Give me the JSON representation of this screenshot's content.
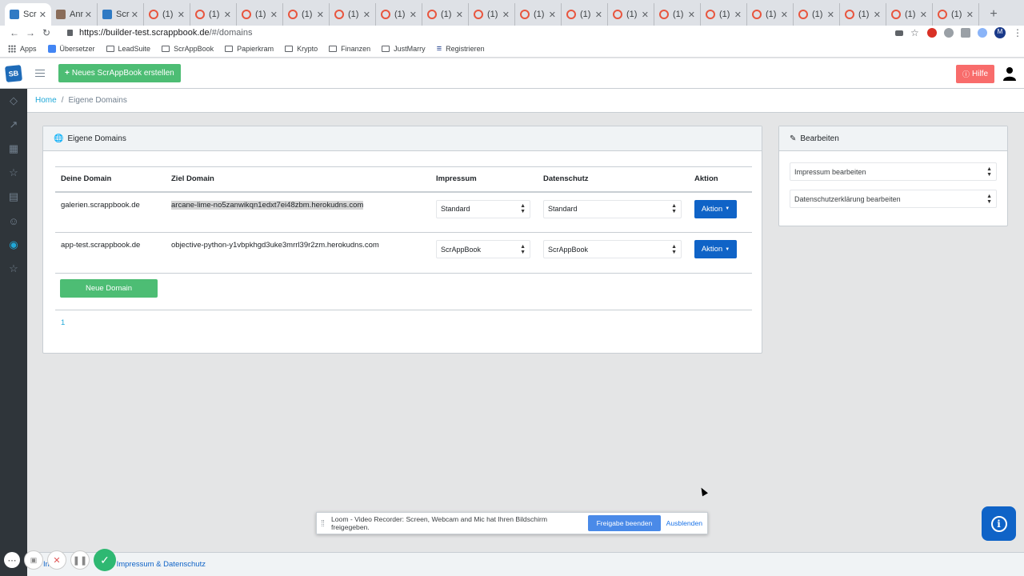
{
  "browser": {
    "tabs": [
      {
        "title": "Scr",
        "icon": "scrappbook-favicon",
        "active": true
      },
      {
        "title": "Ann",
        "icon": "photo-favicon"
      },
      {
        "title": "Scr",
        "icon": "scrappbook-favicon"
      },
      {
        "title": "(1)",
        "icon": "spiral-favicon"
      },
      {
        "title": "(1)",
        "icon": "spiral-favicon"
      },
      {
        "title": "(1)",
        "icon": "spiral-favicon"
      },
      {
        "title": "(1)",
        "icon": "spiral-favicon"
      },
      {
        "title": "(1)",
        "icon": "spiral-favicon"
      },
      {
        "title": "(1)",
        "icon": "spiral-favicon"
      },
      {
        "title": "(1)",
        "icon": "spiral-favicon"
      },
      {
        "title": "(1)",
        "icon": "spiral-favicon"
      },
      {
        "title": "(1)",
        "icon": "spiral-favicon"
      },
      {
        "title": "(1)",
        "icon": "spiral-favicon"
      },
      {
        "title": "(1)",
        "icon": "spiral-favicon"
      },
      {
        "title": "(1)",
        "icon": "spiral-favicon"
      },
      {
        "title": "(1)",
        "icon": "spiral-favicon"
      },
      {
        "title": "(1)",
        "icon": "spiral-favicon"
      },
      {
        "title": "(1)",
        "icon": "spiral-favicon"
      },
      {
        "title": "(1)",
        "icon": "spiral-favicon"
      },
      {
        "title": "(1)",
        "icon": "spiral-favicon"
      },
      {
        "title": "(1)",
        "icon": "spiral-favicon"
      }
    ],
    "url_host": "https://builder-test.scrappbook.de",
    "url_path": "/#/domains",
    "profile_initial": "M",
    "bookmarks": [
      {
        "label": "Apps",
        "icon": "apps-grid-icon"
      },
      {
        "label": "Übersetzer",
        "icon": "translate-icon"
      },
      {
        "label": "LeadSuite",
        "icon": "folder-icon"
      },
      {
        "label": "ScrAppBook",
        "icon": "folder-icon"
      },
      {
        "label": "Papierkram",
        "icon": "folder-icon"
      },
      {
        "label": "Krypto",
        "icon": "folder-icon"
      },
      {
        "label": "Finanzen",
        "icon": "folder-icon"
      },
      {
        "label": "JustMarry",
        "icon": "folder-icon"
      },
      {
        "label": "Registrieren",
        "icon": "filter-icon"
      }
    ]
  },
  "header": {
    "logo": "SB",
    "new_button": "Neues ScrAppBook erstellen",
    "help_button": "Hilfe"
  },
  "breadcrumb": {
    "home": "Home",
    "current": "Eigene Domains"
  },
  "domains_card": {
    "title": "Eigene Domains",
    "columns": [
      "Deine Domain",
      "Ziel Domain",
      "Impressum",
      "Datenschutz",
      "Aktion"
    ],
    "rows": [
      {
        "domain": "galerien.scrappbook.de",
        "target": "arcane-lime-no5zanwikqn1edxt7ei48zbm.herokudns.com",
        "impressum": "Standard",
        "datenschutz": "Standard",
        "action": "Aktion"
      },
      {
        "domain": "app-test.scrappbook.de",
        "target": "objective-python-y1vbpkhgd3uke3mrrl39r2zm.herokudns.com",
        "impressum": "ScrAppBook",
        "datenschutz": "ScrAppBook",
        "action": "Aktion"
      }
    ],
    "new_domain_button": "Neue Domain",
    "page": "1"
  },
  "edit_card": {
    "title": "Bearbeiten",
    "select_impressum": "Impressum bearbeiten",
    "select_datenschutz": "Datenschutzerklärung bearbeiten"
  },
  "loom": {
    "message": "Loom - Video Recorder: Screen, Webcam and Mic hat Ihren Bildschirm freigegeben.",
    "stop_button": "Freigabe beenden",
    "hide_button": "Ausblenden"
  },
  "footer": {
    "left": "Im",
    "link": "Impressum & Datenschutz"
  },
  "colors": {
    "primary": "#0f63c7",
    "success": "#4dbd74",
    "danger": "#f86c6b",
    "sidebar": "#2f353a"
  }
}
